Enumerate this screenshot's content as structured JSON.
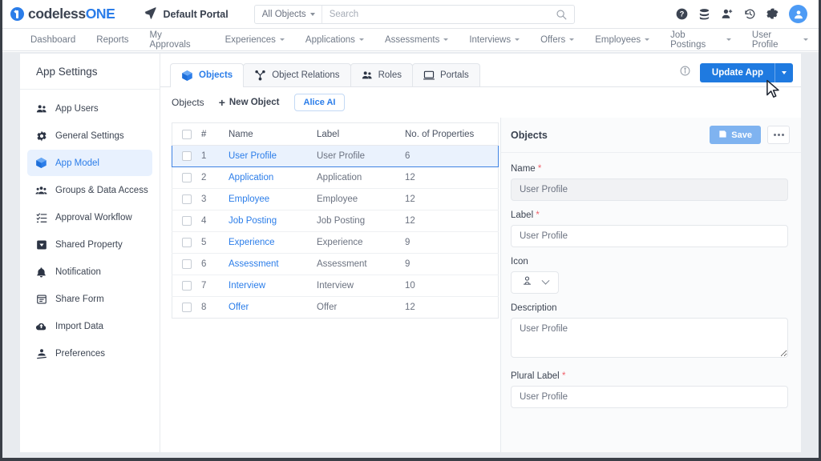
{
  "topbar": {
    "brand_dark": "codeless",
    "brand_blue": "ONE",
    "portal_label": "Default Portal",
    "search_scope": "All Objects",
    "search_placeholder": "Search",
    "search_value": "",
    "icons": [
      "help-icon",
      "database-icon",
      "add-user-icon",
      "history-icon",
      "settings-icon",
      "avatar-icon"
    ]
  },
  "menubar": {
    "items": [
      {
        "label": "Dashboard",
        "has_caret": false
      },
      {
        "label": "Reports",
        "has_caret": false
      },
      {
        "label": "My Approvals",
        "has_caret": false
      },
      {
        "label": "Experiences",
        "has_caret": true
      },
      {
        "label": "Applications",
        "has_caret": true
      },
      {
        "label": "Assessments",
        "has_caret": true
      },
      {
        "label": "Interviews",
        "has_caret": true
      },
      {
        "label": "Offers",
        "has_caret": true
      },
      {
        "label": "Employees",
        "has_caret": true
      },
      {
        "label": "Job Postings",
        "has_caret": true
      },
      {
        "label": "User Profile",
        "has_caret": true
      }
    ]
  },
  "sidebar": {
    "title": "App Settings",
    "items": [
      {
        "label": "App Users",
        "icon": "users-icon",
        "active": false
      },
      {
        "label": "General Settings",
        "icon": "gear-icon",
        "active": false
      },
      {
        "label": "App Model",
        "icon": "cube-icon",
        "active": true
      },
      {
        "label": "Groups & Data Access",
        "icon": "group-users-icon",
        "active": false
      },
      {
        "label": "Approval Workflow",
        "icon": "checklist-icon",
        "active": false
      },
      {
        "label": "Shared Property",
        "icon": "tag-icon",
        "active": false
      },
      {
        "label": "Notification",
        "icon": "bell-icon",
        "active": false
      },
      {
        "label": "Share Form",
        "icon": "form-icon",
        "active": false
      },
      {
        "label": "Import Data",
        "icon": "cloud-upload-icon",
        "active": false
      },
      {
        "label": "Preferences",
        "icon": "preferences-icon",
        "active": false
      }
    ]
  },
  "tabs": [
    {
      "label": "Objects",
      "icon": "cube-icon",
      "active": true
    },
    {
      "label": "Object Relations",
      "icon": "relations-icon",
      "active": false
    },
    {
      "label": "Roles",
      "icon": "users-icon",
      "active": false
    },
    {
      "label": "Portals",
      "icon": "monitor-icon",
      "active": false
    }
  ],
  "tab_actions": {
    "info_icon": "info-icon",
    "update_button": "Update App"
  },
  "subbar": {
    "title": "Objects",
    "new_object": "New Object",
    "alice_ai": "Alice AI"
  },
  "table": {
    "columns": [
      "#",
      "Name",
      "Label",
      "No. of Properties"
    ],
    "rows": [
      {
        "num": "1",
        "name": "User Profile",
        "label": "User Profile",
        "props": "6",
        "selected": true
      },
      {
        "num": "2",
        "name": "Application",
        "label": "Application",
        "props": "12",
        "selected": false
      },
      {
        "num": "3",
        "name": "Employee",
        "label": "Employee",
        "props": "12",
        "selected": false
      },
      {
        "num": "4",
        "name": "Job Posting",
        "label": "Job Posting",
        "props": "12",
        "selected": false
      },
      {
        "num": "5",
        "name": "Experience",
        "label": "Experience",
        "props": "9",
        "selected": false
      },
      {
        "num": "6",
        "name": "Assessment",
        "label": "Assessment",
        "props": "9",
        "selected": false
      },
      {
        "num": "7",
        "name": "Interview",
        "label": "Interview",
        "props": "10",
        "selected": false
      },
      {
        "num": "8",
        "name": "Offer",
        "label": "Offer",
        "props": "12",
        "selected": false
      }
    ]
  },
  "detail": {
    "title": "Objects",
    "save_label": "Save",
    "fields": {
      "name_label": "Name",
      "name_value": "User Profile",
      "label_label": "Label",
      "label_value": "User Profile",
      "icon_label": "Icon",
      "icon_value": "person-icon",
      "description_label": "Description",
      "description_value": "User Profile",
      "plural_label": "Plural Label",
      "plural_value": "User Profile"
    }
  },
  "colors": {
    "accent": "#2b7de9",
    "primary_button": "#1f7ae0",
    "selected_row": "#eaf2fd",
    "required": "#f0626c",
    "page_bg": "#e8ebef"
  }
}
